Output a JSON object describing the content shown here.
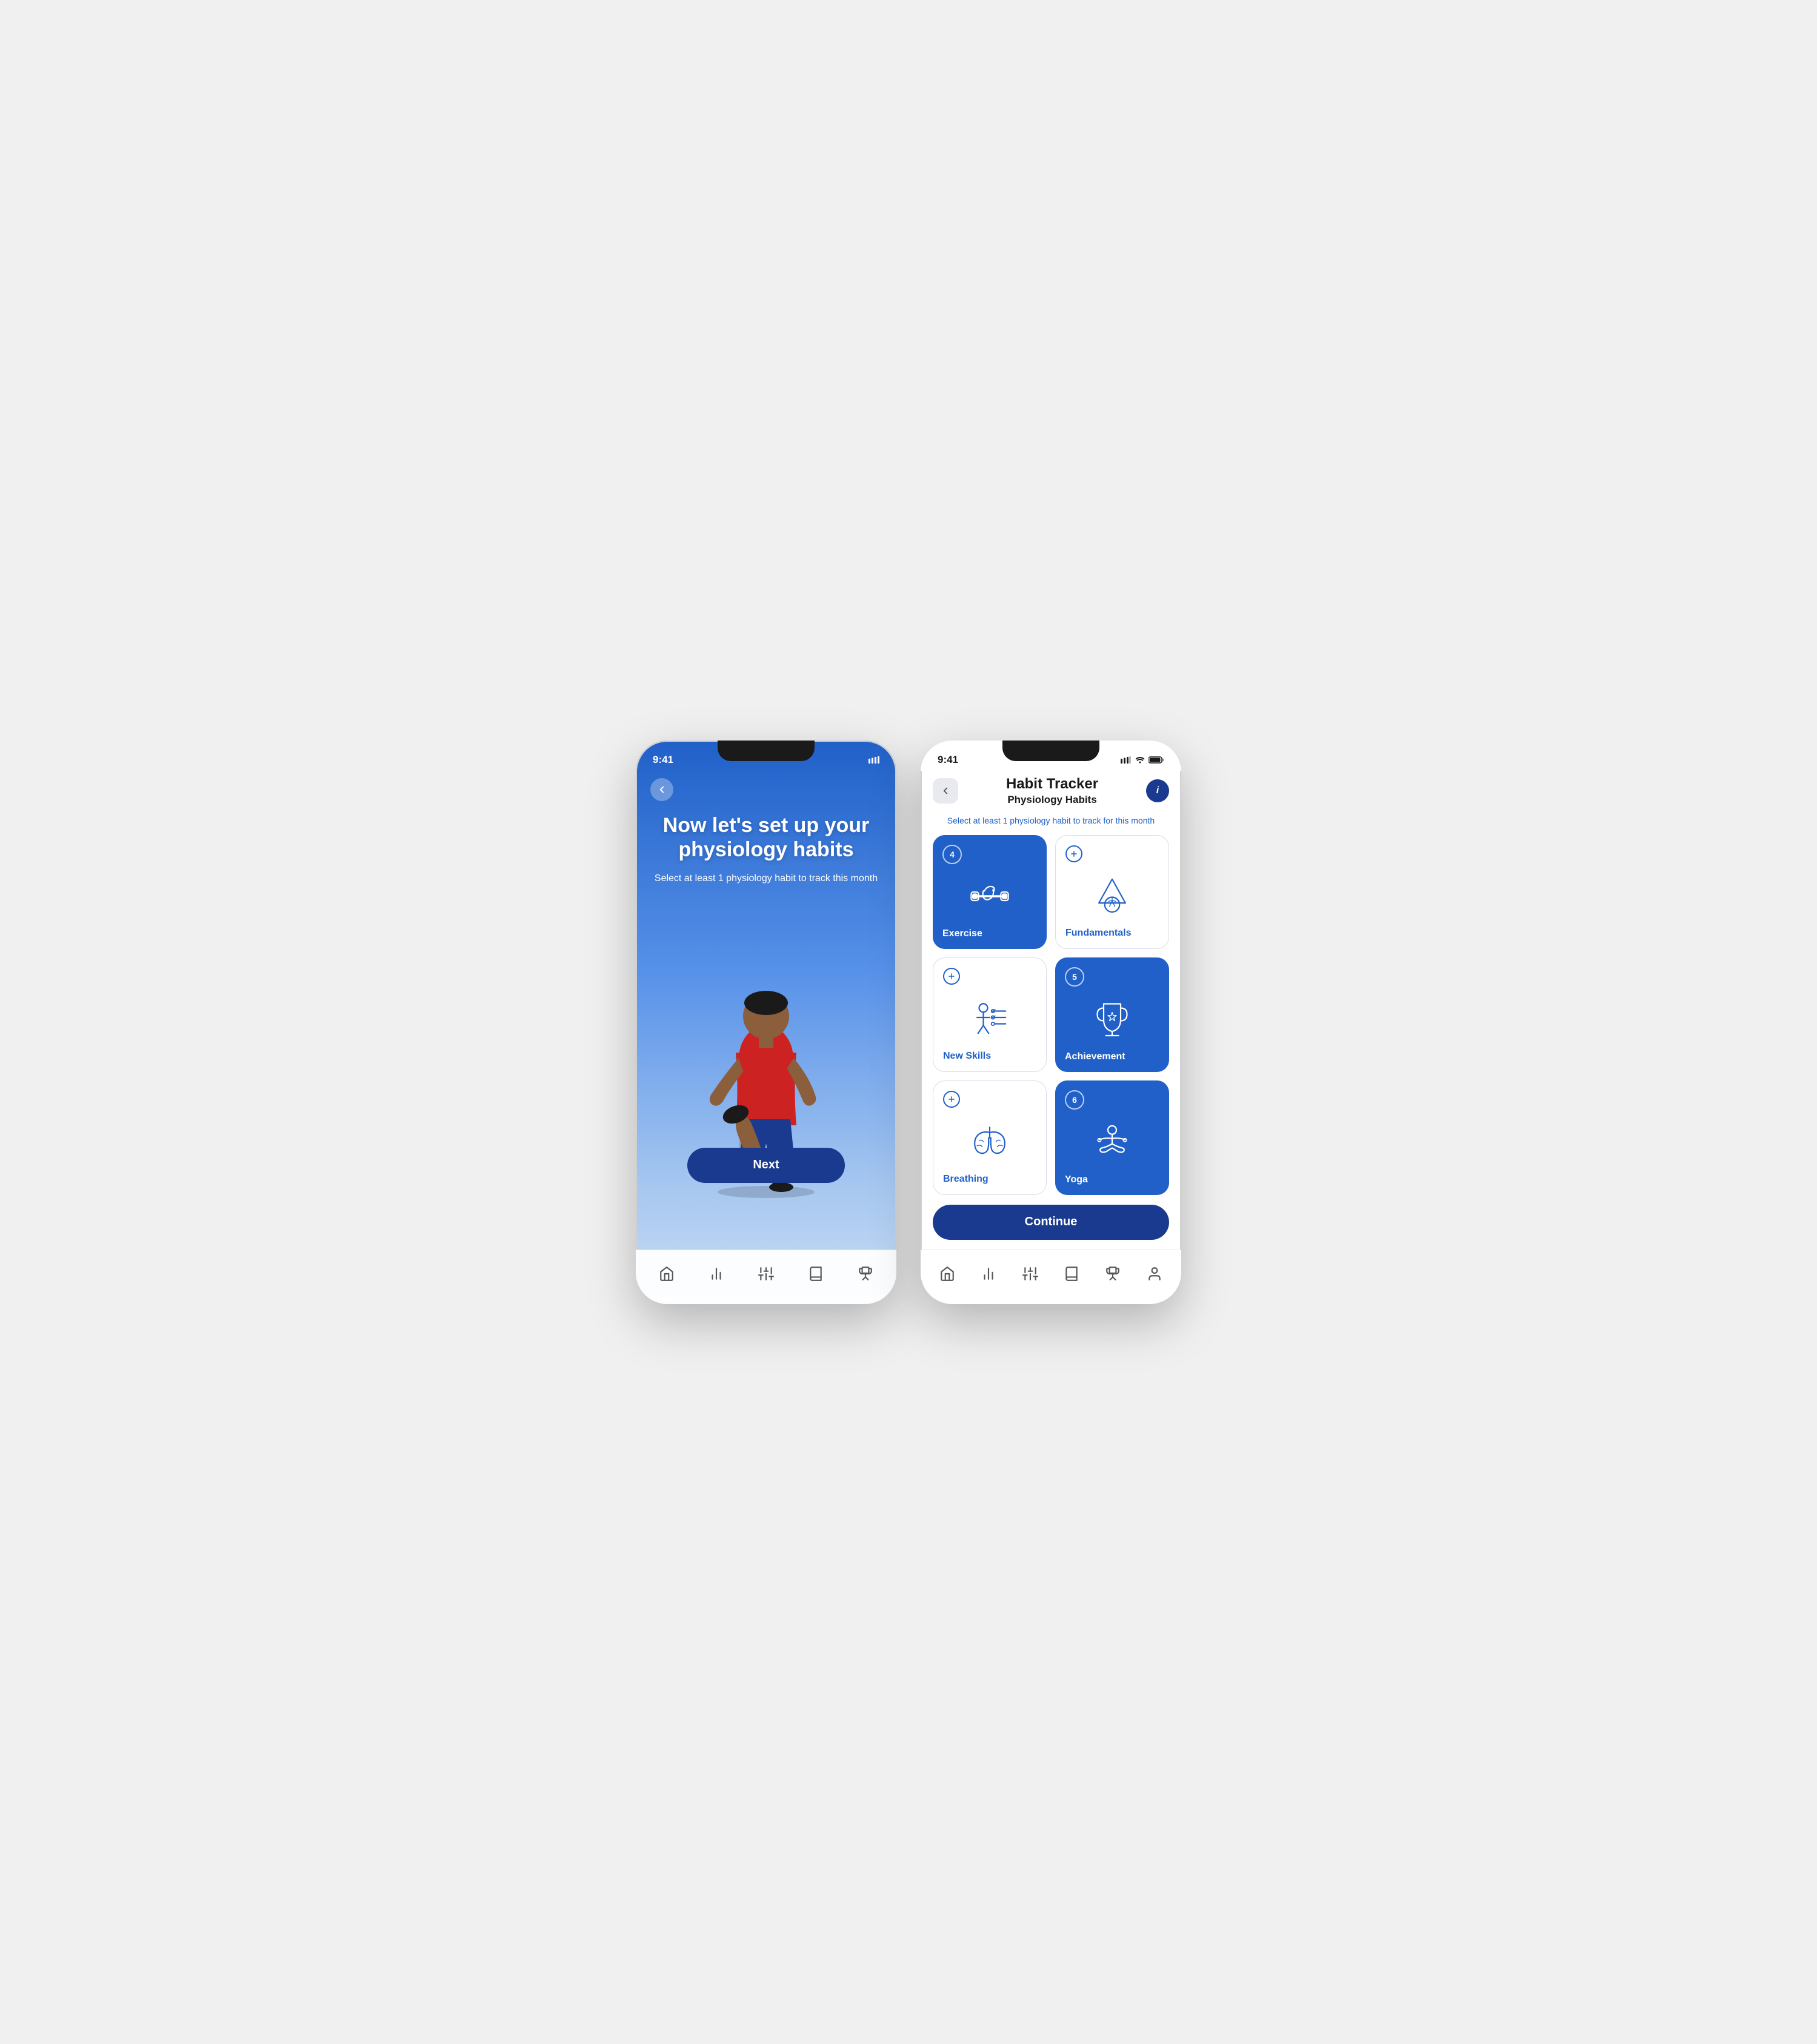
{
  "phone1": {
    "time": "9:41",
    "headline": "Now let's set up your physiology habits",
    "subtitle": "Select at least 1 physiology habit to track this month",
    "next_button": "Next",
    "nav_items": [
      "home",
      "chart",
      "sliders",
      "book",
      "trophy"
    ]
  },
  "phone2": {
    "time": "9:41",
    "title": "Habit Tracker",
    "subtitle": "Physiology Habits",
    "instruction": "Select at least 1 physiology habit to track for this month",
    "continue_button": "Continue",
    "habits": [
      {
        "id": "exercise",
        "label": "Exercise",
        "selected": true,
        "badge": "4",
        "badge_type": "number"
      },
      {
        "id": "fundamentals",
        "label": "Fundamentals",
        "selected": false,
        "badge_type": "plus"
      },
      {
        "id": "new-skills",
        "label": "New Skills",
        "selected": false,
        "badge_type": "plus"
      },
      {
        "id": "achievement",
        "label": "Achievement",
        "selected": true,
        "badge": "5",
        "badge_type": "number"
      },
      {
        "id": "breathing",
        "label": "Breathing",
        "selected": false,
        "badge_type": "plus"
      },
      {
        "id": "yoga",
        "label": "Yoga",
        "selected": true,
        "badge": "6",
        "badge_type": "number"
      }
    ],
    "nav_items": [
      "home",
      "chart",
      "sliders",
      "book",
      "trophy",
      "person"
    ]
  }
}
